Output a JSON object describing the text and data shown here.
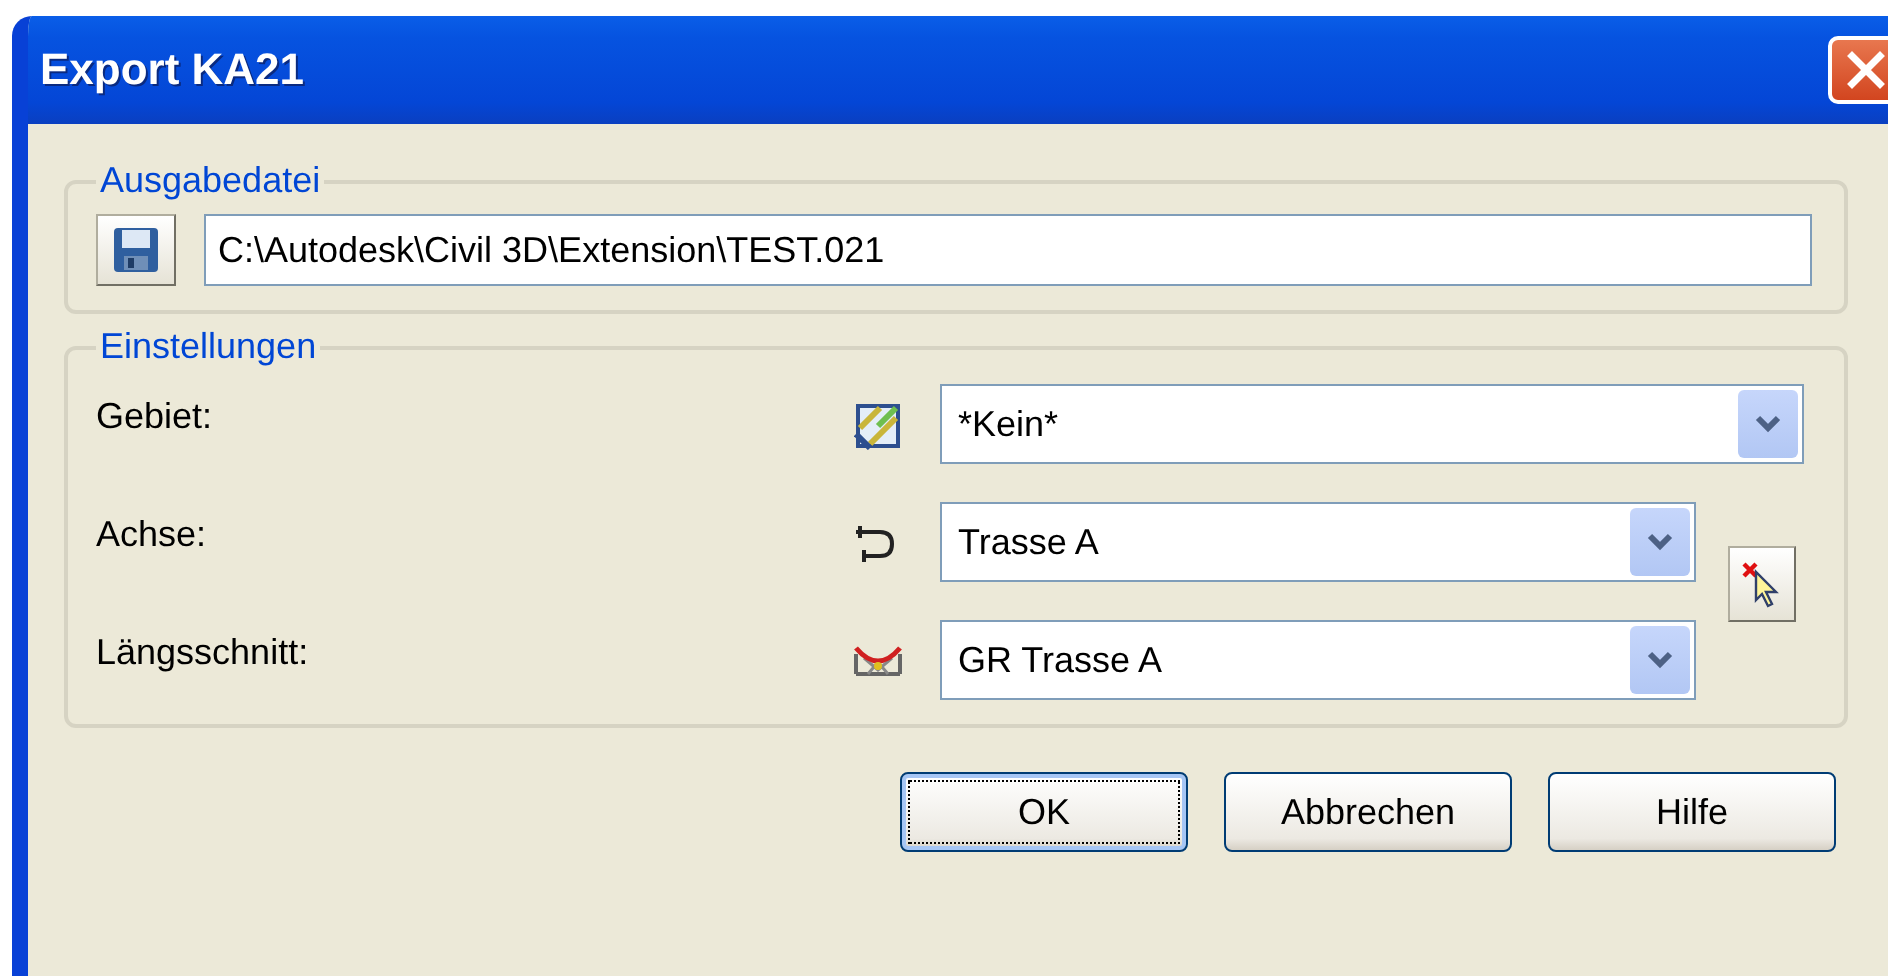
{
  "window": {
    "title": "Export KA21"
  },
  "output": {
    "legend": "Ausgabedatei",
    "path": "C:\\Autodesk\\Civil 3D\\Extension\\TEST.021"
  },
  "settings": {
    "legend": "Einstellungen",
    "rows": [
      {
        "label": "Gebiet:",
        "value": "*Kein*",
        "wide": true
      },
      {
        "label": "Achse:",
        "value": "Trasse A",
        "wide": false
      },
      {
        "label": "Längsschnitt:",
        "value": "GR Trasse A",
        "wide": false
      }
    ]
  },
  "buttons": [
    {
      "label": "OK",
      "focused": true
    },
    {
      "label": "Abbrechen",
      "focused": false
    },
    {
      "label": "Hilfe",
      "focused": false
    }
  ]
}
